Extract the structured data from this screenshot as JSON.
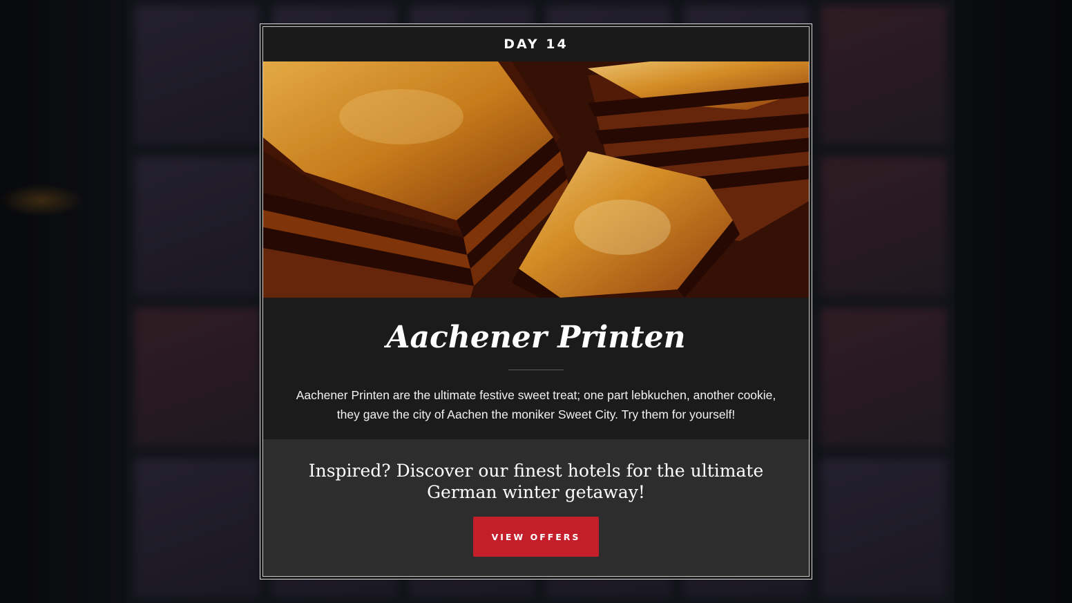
{
  "modal": {
    "day_label": "DAY 14",
    "image_alt": "Stacked Aachener Printen gingerbread cookies",
    "title": "Aachener Printen",
    "description": "Aachener Printen are the ultimate festive sweet treat; one part lebkuchen, another cookie, they gave the city of Aachen the moniker Sweet City. Try them for yourself!"
  },
  "cta": {
    "text": "Inspired? Discover our finest hotels for the ultimate German winter getaway!",
    "button_label": "VIEW OFFERS"
  },
  "background_tiles": [
    "",
    "",
    "",
    "",
    "",
    "",
    "",
    "",
    "",
    "",
    "",
    "",
    "",
    "",
    "",
    "",
    "",
    "",
    "",
    "",
    "",
    "",
    "",
    ""
  ],
  "colors": {
    "accent": "#c41e2a",
    "modal_bg": "#1b1b1b",
    "cta_bg": "#2d2d2d"
  }
}
